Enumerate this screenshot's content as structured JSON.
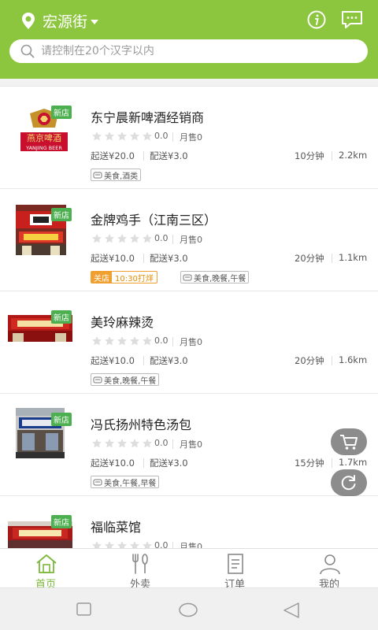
{
  "header": {
    "location": "宏源街",
    "search_placeholder": "请控制在20个汉字以内"
  },
  "shops": [
    {
      "name": "东宁晨新啤酒经销商",
      "badge": "新店",
      "rating": "0.0",
      "sales": "月售0",
      "min_order": "起送¥20.0",
      "delivery_fee": "配送¥3.0",
      "time": "10分钟",
      "distance": "2.2km",
      "tags": "美食,酒类",
      "logo_text": "燕京啤酒",
      "logo_sub": "YANJING BEER"
    },
    {
      "name": "金牌鸡手（江南三区）",
      "badge": "新店",
      "rating": "0.0",
      "sales": "月售0",
      "min_order": "起送¥10.0",
      "delivery_fee": "配送¥3.0",
      "time": "20分钟",
      "distance": "1.1km",
      "status": "关店",
      "open_time": "10:30打烊",
      "tags": "美食,晚餐,午餐"
    },
    {
      "name": "美玲麻辣烫",
      "badge": "新店",
      "rating": "0.0",
      "sales": "月售0",
      "min_order": "起送¥10.0",
      "delivery_fee": "配送¥3.0",
      "time": "20分钟",
      "distance": "1.6km",
      "tags": "美食,晚餐,午餐"
    },
    {
      "name": "冯氏扬州特色汤包",
      "badge": "新店",
      "rating": "0.0",
      "sales": "月售0",
      "min_order": "起送¥10.0",
      "delivery_fee": "配送¥3.0",
      "time": "15分钟",
      "distance": "1.7km",
      "tags": "美食,午餐,早餐"
    },
    {
      "name": "福临菜馆",
      "badge": "新店",
      "rating": "0.0",
      "sales": "月售0"
    }
  ],
  "tabs": [
    {
      "label": "首页",
      "icon": "home-icon",
      "active": true
    },
    {
      "label": "外卖",
      "icon": "fork-knife-icon"
    },
    {
      "label": "订单",
      "icon": "order-icon"
    },
    {
      "label": "我的",
      "icon": "user-icon"
    }
  ],
  "colors": {
    "brand": "#8cc63e",
    "active_tab": "#7cb83a",
    "new_badge": "#4caf50",
    "closed": "#f0a030"
  }
}
